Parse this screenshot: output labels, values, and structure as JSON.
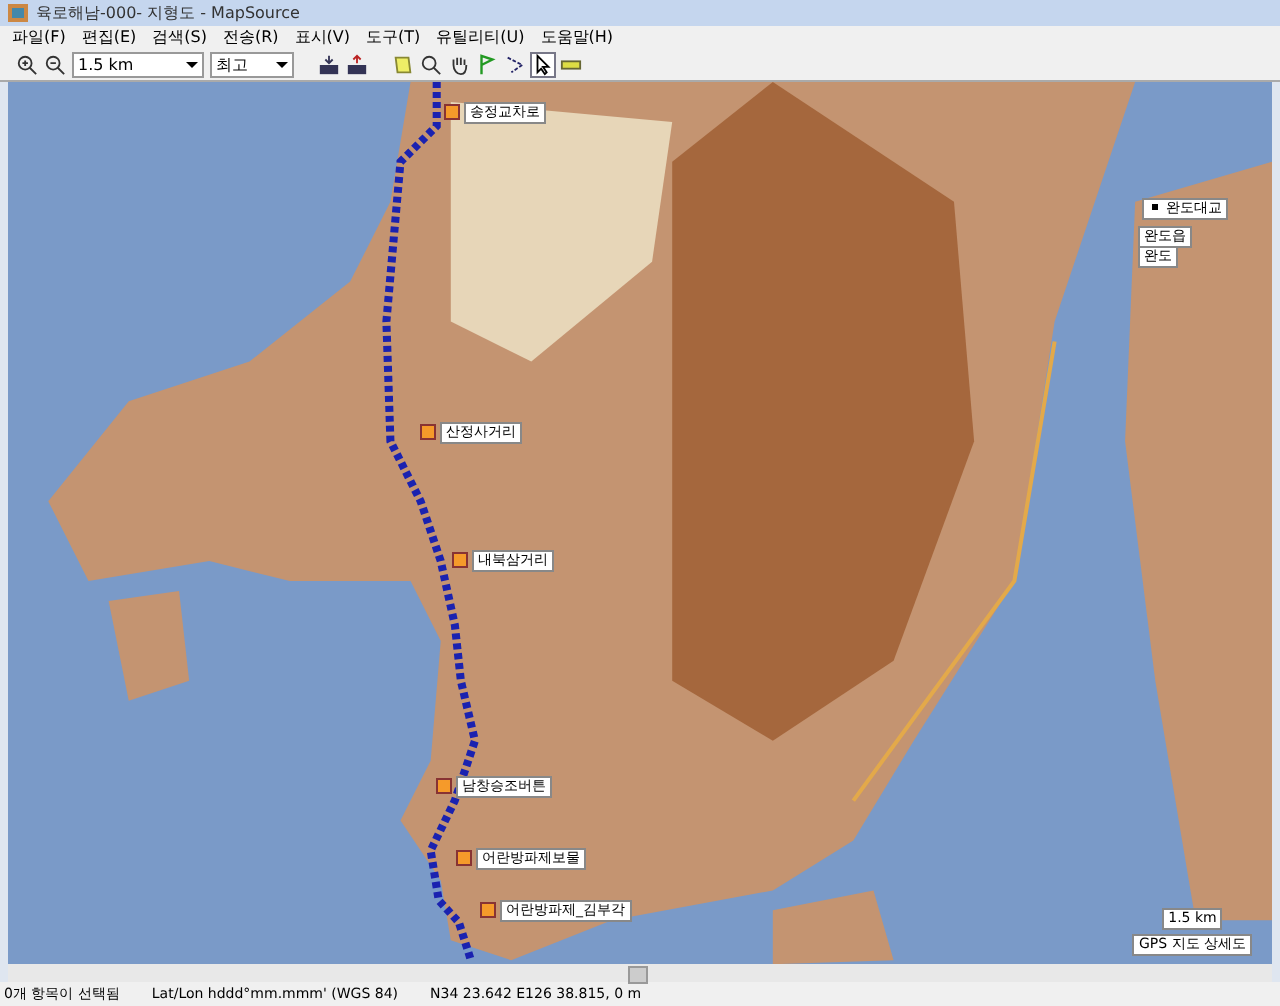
{
  "window": {
    "title": "육로해남-000- 지형도 - MapSource"
  },
  "menu": [
    "파일(F)",
    "편집(E)",
    "검색(S)",
    "전송(R)",
    "표시(V)",
    "도구(T)",
    "유틸리티(U)",
    "도움말(H)"
  ],
  "toolbar": {
    "zoom_scale": "1.5 km",
    "detail": "최고"
  },
  "waypoints": [
    {
      "label": "송정교차로"
    },
    {
      "label": "산정사거리"
    },
    {
      "label": "내북삼거리"
    },
    {
      "label": "남창승조버튼"
    },
    {
      "label": "어란방파제보물"
    },
    {
      "label": "어란방파제_김부각"
    }
  ],
  "places": [
    {
      "label": "완도대교",
      "kind": "bullet"
    },
    {
      "label": "완도읍",
      "kind": "plain"
    },
    {
      "label": "완도",
      "kind": "plain"
    }
  ],
  "scale": {
    "distance": "1.5 km",
    "map_name": "GPS 지도 상세도"
  },
  "status_bar": {
    "selection": "0개 항목이 선택됨",
    "format": "Lat/Lon hddd°mm.mmm' (WGS 84)",
    "position": "N34 23.642 E126 38.815, 0 m"
  }
}
